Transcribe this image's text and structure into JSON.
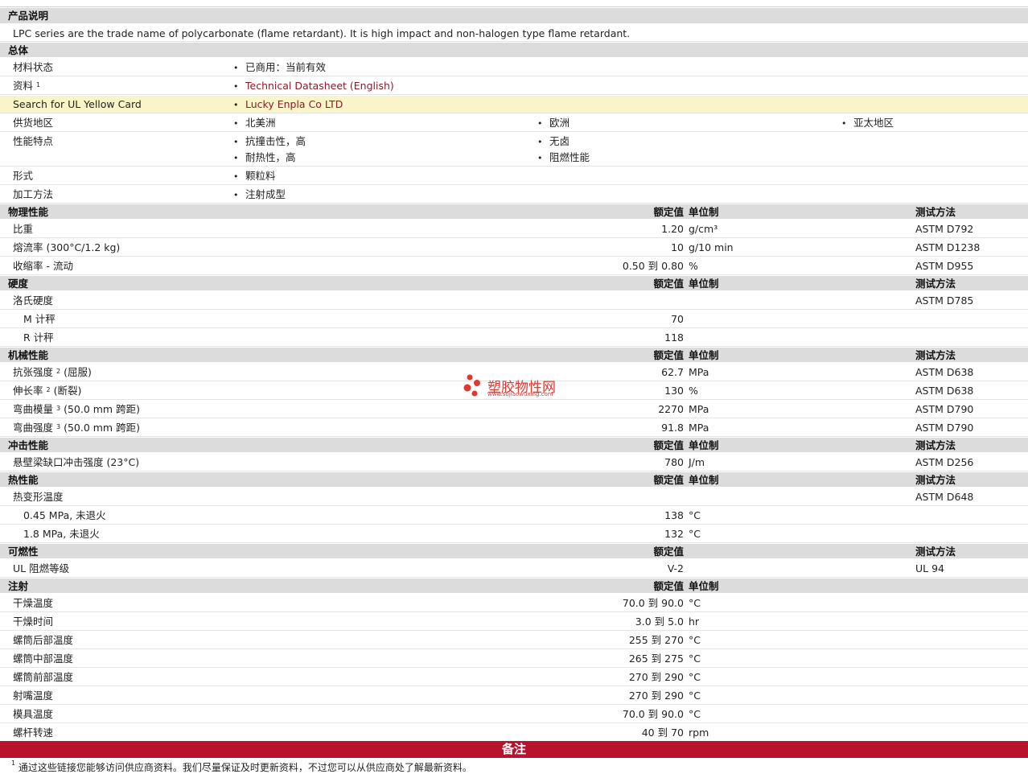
{
  "product_description": {
    "heading": "产品说明",
    "text": "LPC series are the trade name of polycarbonate (flame retardant). It is high impact and non-halogen type flame retardant."
  },
  "general": {
    "heading": "总体",
    "material_status_label": "材料状态",
    "material_status_value": "已商用：当前有效",
    "literature_label": "资料",
    "literature_sup": "1",
    "literature_value": "Technical Datasheet (English)",
    "ul_label": "Search for UL Yellow Card",
    "ul_value": "Lucky Enpla Co LTD",
    "supply_label": "供货地区",
    "supply_values": [
      "北美洲",
      "欧洲",
      "亚太地区"
    ],
    "features_label": "性能特点",
    "features_values": [
      "抗撞击性，高",
      "无卤",
      "耐热性，高",
      "阻燃性能"
    ],
    "form_label": "形式",
    "form_value": "颗粒料",
    "processing_label": "加工方法",
    "processing_value": "注射成型"
  },
  "headers": {
    "nominal": "额定值",
    "unit": "单位制",
    "test": "测试方法"
  },
  "physical": {
    "heading": "物理性能",
    "rows": [
      {
        "label": "比重",
        "value": "1.20",
        "unit": "g/cm³",
        "test": "ASTM D792"
      },
      {
        "label": "熔流率  (300°C/1.2 kg)",
        "value": "10",
        "unit": "g/10 min",
        "test": "ASTM D1238"
      },
      {
        "label": "收缩率  - 流动",
        "value": "0.50 到  0.80",
        "unit": "%",
        "test": "ASTM D955"
      }
    ]
  },
  "hardness": {
    "heading": "硬度",
    "parent_label": "洛氏硬度",
    "parent_test": "ASTM D785",
    "rows": [
      {
        "label": "M 计秤",
        "value": "70"
      },
      {
        "label": "R 计秤",
        "value": "118"
      }
    ]
  },
  "mechanical": {
    "heading": "机械性能",
    "rows": [
      {
        "label": "抗张强度",
        "sup": "2",
        "suffix": " (屈服)",
        "value": "62.7",
        "unit": "MPa",
        "test": "ASTM D638"
      },
      {
        "label": "伸长率",
        "sup": "2",
        "suffix": " (断裂)",
        "value": "130",
        "unit": "%",
        "test": "ASTM D638"
      },
      {
        "label": "弯曲模量",
        "sup": "3",
        "suffix": " (50.0 mm 跨距)",
        "value": "2270",
        "unit": "MPa",
        "test": "ASTM D790"
      },
      {
        "label": "弯曲强度",
        "sup": "3",
        "suffix": " (50.0 mm 跨距)",
        "value": "91.8",
        "unit": "MPa",
        "test": "ASTM D790"
      }
    ]
  },
  "impact": {
    "heading": "冲击性能",
    "rows": [
      {
        "label": "悬壁梁缺口冲击强度  (23°C)",
        "value": "780",
        "unit": "J/m",
        "test": "ASTM D256"
      }
    ]
  },
  "thermal": {
    "heading": "热性能",
    "parent_label": "热变形温度",
    "parent_test": "ASTM D648",
    "rows": [
      {
        "label": "0.45 MPa, 未退火",
        "value": "138",
        "unit": "°C"
      },
      {
        "label": "1.8 MPa, 未退火",
        "value": "132",
        "unit": "°C"
      }
    ]
  },
  "flammability": {
    "heading": "可燃性",
    "rows": [
      {
        "label": "UL 阻燃等级",
        "value": "V-2",
        "test": "UL 94"
      }
    ]
  },
  "injection": {
    "heading": "注射",
    "rows": [
      {
        "label": "干燥温度",
        "value": "70.0 到  90.0",
        "unit": "°C"
      },
      {
        "label": "干燥时间",
        "value": "3.0 到  5.0",
        "unit": "hr"
      },
      {
        "label": "螺筒后部温度",
        "value": "255 到  270",
        "unit": "°C"
      },
      {
        "label": "螺筒中部温度",
        "value": "265 到  275",
        "unit": "°C"
      },
      {
        "label": "螺筒前部温度",
        "value": "270 到  290",
        "unit": "°C"
      },
      {
        "label": "射嘴温度",
        "value": "270 到  290",
        "unit": "°C"
      },
      {
        "label": "模具温度",
        "value": "70.0 到  90.0",
        "unit": "°C"
      },
      {
        "label": "螺杆转速",
        "value": "40 到  70",
        "unit": "rpm"
      }
    ]
  },
  "notes": {
    "heading": "备注",
    "footnote_sup": "1",
    "footnote_text": "通过这些链接您能够访问供应商资料。我们尽量保证及时更新资料，不过您可以从供应商处了解最新资料。"
  },
  "watermark": {
    "name": "塑胶物性网",
    "url": "www.sujiaowuxing.com",
    "color": "#e0382f"
  }
}
